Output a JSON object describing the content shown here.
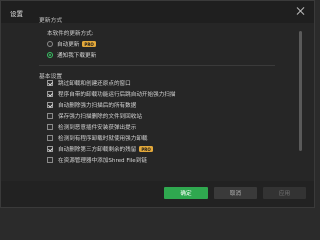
{
  "window": {
    "title": "设置"
  },
  "update_section": {
    "header": "更新方式",
    "question": "本软件的更新方式:",
    "options": [
      {
        "label": "自动更新",
        "badge": "PRO",
        "selected": false
      },
      {
        "label": "通知我下载更新",
        "badge": "",
        "selected": true
      }
    ]
  },
  "basic_section": {
    "header": "基本设置",
    "options": [
      {
        "label": "跳过卸载和创建还原点的窗口",
        "badge": "",
        "checked": true
      },
      {
        "label": "程序自带的卸载功能运行后跳自动开始强力扫描",
        "badge": "",
        "checked": true
      },
      {
        "label": "自动删除强力扫描后的所有数据",
        "badge": "",
        "checked": true
      },
      {
        "label": "保存强力扫描删除的文件到回收站",
        "badge": "",
        "checked": false
      },
      {
        "label": "检测到恶意插件安装获弹出提示",
        "badge": "",
        "checked": false
      },
      {
        "label": "检测到有程序卸载时就使用强力卸载",
        "badge": "",
        "checked": false
      },
      {
        "label": "自动删除第三方卸载剩余的残留",
        "badge": "PRO",
        "checked": true
      },
      {
        "label": "在资源管理器中添加Shred File到链",
        "badge": "",
        "checked": false
      }
    ]
  },
  "footer": {
    "ok_label": "确定",
    "cancel_label": "取消",
    "apply_label": "应用"
  },
  "colors": {
    "accent": "#2fa84f",
    "badge": "#e3a83a"
  }
}
